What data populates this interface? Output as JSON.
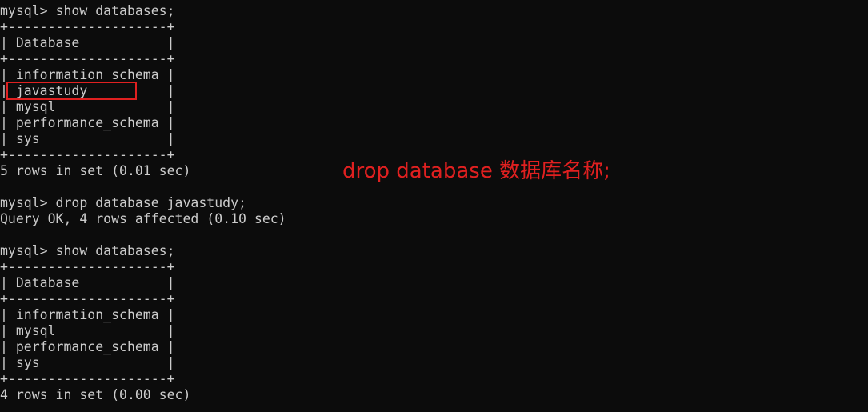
{
  "terminal": {
    "lines": [
      "mysql> show databases;",
      "+--------------------+",
      "| Database           |",
      "+--------------------+",
      "| information_schema |",
      "| javastudy          |",
      "| mysql              |",
      "| performance_schema |",
      "| sys                |",
      "+--------------------+",
      "5 rows in set (0.01 sec)",
      "",
      "mysql> drop database javastudy;",
      "Query OK, 4 rows affected (0.10 sec)",
      "",
      "mysql> show databases;",
      "+--------------------+",
      "| Database           |",
      "+--------------------+",
      "| information_schema |",
      "| mysql              |",
      "| performance_schema |",
      "| sys                |",
      "+--------------------+",
      "4 rows in set (0.00 sec)"
    ]
  },
  "annotation": {
    "text": "drop database 数据库名称;",
    "color": "#e02020"
  },
  "colors": {
    "background": "#0c0c0c",
    "text": "#cccccc",
    "highlight": "#e02020"
  }
}
